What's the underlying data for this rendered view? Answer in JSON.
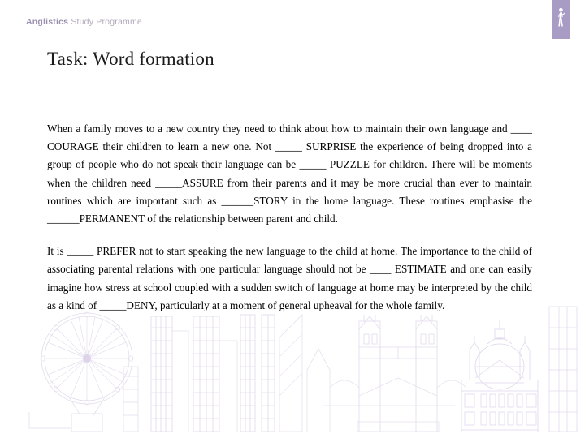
{
  "header": {
    "brand_strong": "Anglistics",
    "brand_light": "Study Programme",
    "logo_icon": "standing-figure-icon",
    "accent_color": "#a99cc4",
    "brand_strong_color": "#9a8fae",
    "brand_light_color": "#b3aabe"
  },
  "slide": {
    "title": "Task: Word formation",
    "paragraphs": [
      "When a family moves to a new country they need to think about how to maintain their own language and ____ COURAGE their children to learn a new one. Not _____ SURPRISE the experience of being dropped into a group of people who do not speak their language can be _____ PUZZLE for children. There will be moments when the children need _____ASSURE from their parents and it may be more crucial than ever to maintain routines which are important such as ______STORY in the home language. These routines emphasise the ______PERMANENT of the relationship between parent and child.",
      "It is _____ PREFER not to start speaking the new language to the child at home. The importance to the child of associating parental relations with one particular language should not be ____ ESTIMATE and one can easily imagine how stress at school coupled with a sudden switch of language at home may be interpreted by the child as a kind of _____DENY, particularly at a moment of general upheaval for the whole family."
    ]
  },
  "watermark": {
    "name": "london-skyline-watermark",
    "line_color": "#ded8e8",
    "accent_color": "#e7dff0",
    "landmarks": [
      "london-eye",
      "office-blocks",
      "tower-bridge",
      "st-pauls-cathedral"
    ]
  }
}
